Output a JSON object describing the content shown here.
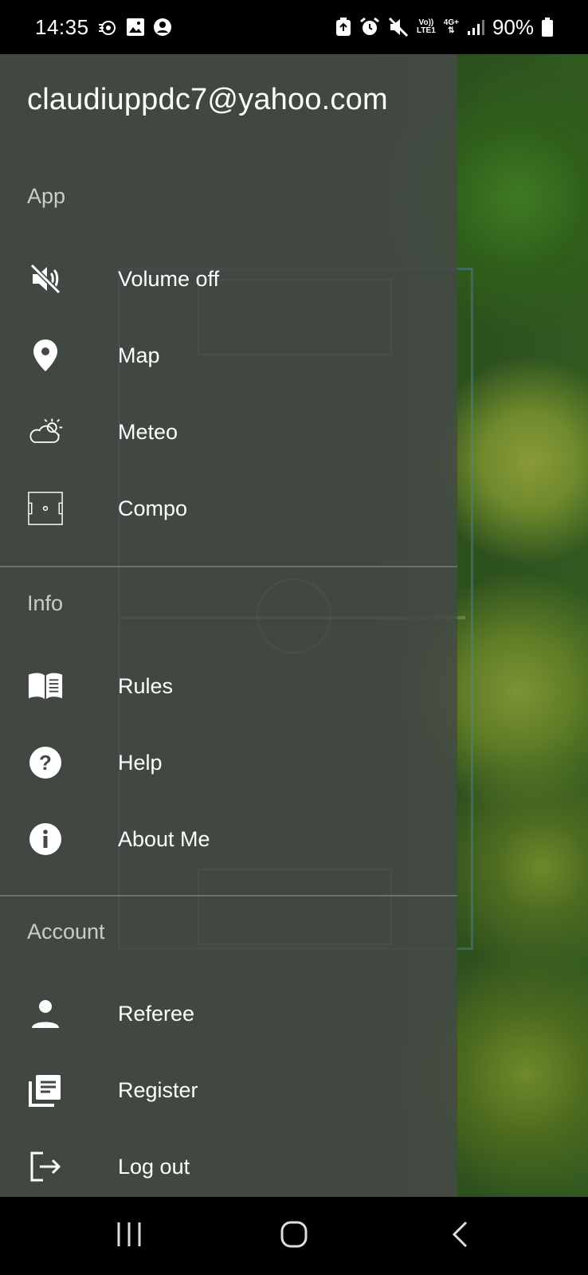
{
  "status_bar": {
    "time": "14:35",
    "battery_percent": "90%",
    "network_volte_top": "Vo))",
    "network_volte_bottom": "LTE1",
    "network_type": "4G+",
    "left_icons": [
      "screen-recorder-icon",
      "gallery-icon",
      "account-circle-icon"
    ],
    "right_icons": [
      "recycle-app-icon",
      "alarm-icon",
      "mute-icon",
      "signal-icon",
      "battery-icon"
    ]
  },
  "drawer": {
    "account_email": "claudiuppdc7@yahoo.com",
    "sections": {
      "app": {
        "title": "App",
        "items": [
          {
            "label": "Volume off",
            "icon": "volume-off-icon"
          },
          {
            "label": "Map",
            "icon": "map-pin-icon"
          },
          {
            "label": "Meteo",
            "icon": "weather-icon"
          },
          {
            "label": "Compo",
            "icon": "pitch-icon"
          }
        ]
      },
      "info": {
        "title": "Info",
        "items": [
          {
            "label": "Rules",
            "icon": "book-icon"
          },
          {
            "label": "Help",
            "icon": "help-icon"
          },
          {
            "label": "About Me",
            "icon": "info-icon"
          }
        ]
      },
      "account": {
        "title": "Account",
        "items": [
          {
            "label": "Referee",
            "icon": "person-icon"
          },
          {
            "label": "Register",
            "icon": "register-icon"
          },
          {
            "label": "Log out",
            "icon": "logout-icon"
          }
        ]
      }
    }
  },
  "nav_bar": {
    "buttons": [
      "recents-icon",
      "home-icon",
      "back-icon"
    ]
  },
  "colors": {
    "drawer_overlay": "#464848",
    "text": "#ffffff",
    "section_header": "#b8b8b8",
    "status_bar": "#000000"
  }
}
